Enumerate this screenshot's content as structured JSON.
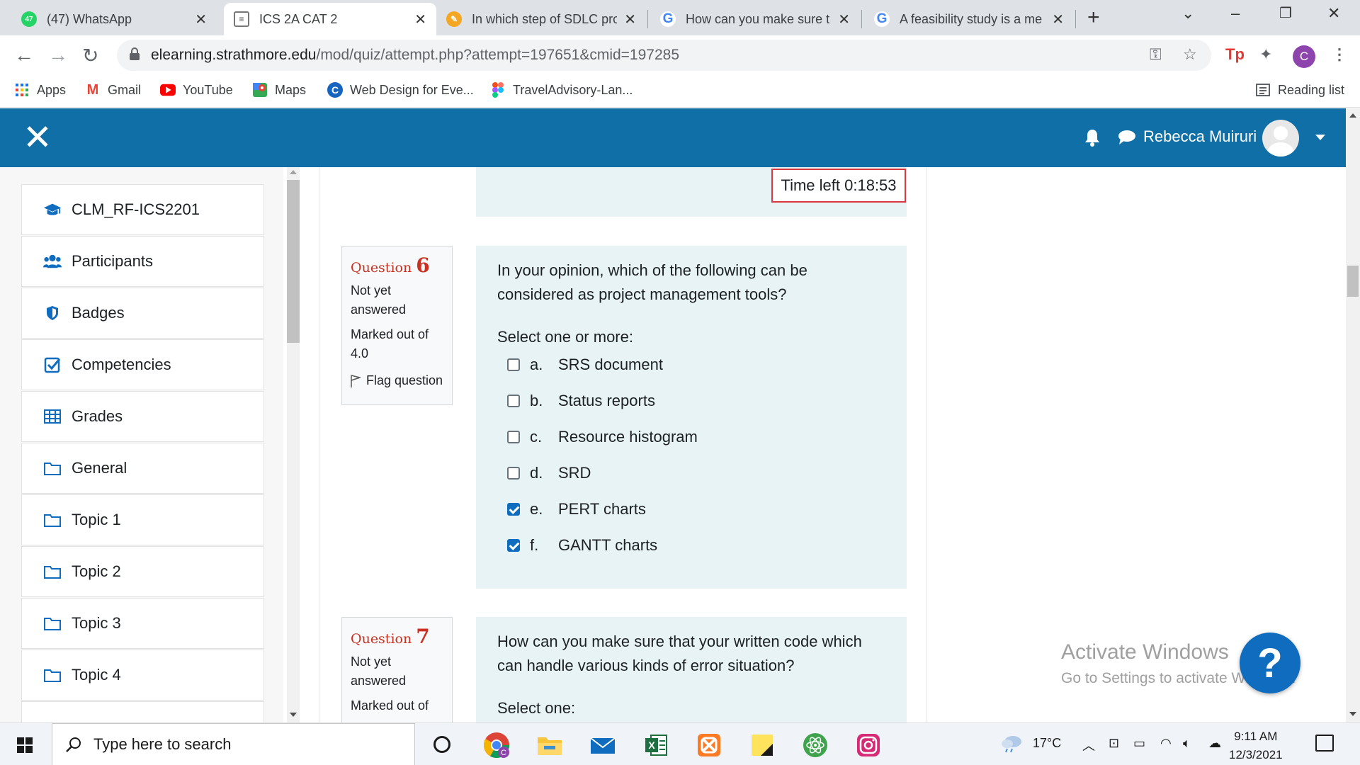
{
  "browser": {
    "tabs": [
      {
        "title": "(47) WhatsApp",
        "badge": "47",
        "icon": "whatsapp-icon",
        "color": "#25d366"
      },
      {
        "title": "ICS 2A CAT 2",
        "icon": "moodle-page-icon",
        "color": "#9e9e9e",
        "active": true
      },
      {
        "title": "In which step of SDLC pro",
        "icon": "quiz-site-icon",
        "color": "#f5a623"
      },
      {
        "title": "How can you make sure t",
        "icon": "google-icon",
        "color": "#4285f4"
      },
      {
        "title": "A feasibility study is a me",
        "icon": "google-icon",
        "color": "#4285f4"
      }
    ],
    "url_host": "elearning.strathmore.edu",
    "url_path": "/mod/quiz/attempt.php?attempt=197651&cmid=197285",
    "profile_initial": "C",
    "bookmarks": [
      {
        "label": "Apps",
        "icon": "apps-grid-icon"
      },
      {
        "label": "Gmail",
        "icon": "gmail-icon"
      },
      {
        "label": "YouTube",
        "icon": "youtube-icon"
      },
      {
        "label": "Maps",
        "icon": "maps-icon"
      },
      {
        "label": "Web Design for Eve...",
        "icon": "web-design-icon"
      },
      {
        "label": "TravelAdvisory-Lan...",
        "icon": "figma-icon"
      }
    ],
    "reading_list": "Reading list"
  },
  "moodle": {
    "user_name": "Rebecca Muiruri",
    "drawer": [
      {
        "label": "CLM_RF-ICS2201",
        "icon": "graduation-cap-icon"
      },
      {
        "label": "Participants",
        "icon": "users-icon"
      },
      {
        "label": "Badges",
        "icon": "shield-icon"
      },
      {
        "label": "Competencies",
        "icon": "check-square-icon"
      },
      {
        "label": "Grades",
        "icon": "table-icon"
      },
      {
        "label": "General",
        "icon": "folder-icon"
      },
      {
        "label": "Topic 1",
        "icon": "folder-icon"
      },
      {
        "label": "Topic 2",
        "icon": "folder-icon"
      },
      {
        "label": "Topic 3",
        "icon": "folder-icon"
      },
      {
        "label": "Topic 4",
        "icon": "folder-icon"
      }
    ],
    "timer": "Time left 0:18:53",
    "q6": {
      "label": "Question",
      "number": "6",
      "state": "Not yet answered",
      "grade": "Marked out of 4.0",
      "flag": "Flag question",
      "text": "In your opinion, which of the following can be considered as project management tools?",
      "prompt": "Select one or more:",
      "answers": [
        {
          "letter": "a.",
          "text": "SRS document",
          "checked": false
        },
        {
          "letter": "b.",
          "text": "Status reports",
          "checked": false
        },
        {
          "letter": "c.",
          "text": "Resource histogram",
          "checked": false
        },
        {
          "letter": "d.",
          "text": "SRD",
          "checked": false
        },
        {
          "letter": "e.",
          "text": "PERT charts",
          "checked": true
        },
        {
          "letter": "f.",
          "text": "GANTT charts",
          "checked": true
        }
      ]
    },
    "q7": {
      "label": "Question",
      "number": "7",
      "state": "Not yet answered",
      "grade": "Marked out of",
      "text": "How can you make sure that your written code which can handle various kinds of error situation?",
      "prompt": "Select one:"
    },
    "help_button": "?"
  },
  "windows": {
    "watermark_title": "Activate Windows",
    "watermark_sub": "Go to Settings to activate Windows.",
    "search_placeholder": "Type here to search",
    "temperature": "17°C",
    "time": "9:11 AM",
    "date": "12/3/2021"
  }
}
